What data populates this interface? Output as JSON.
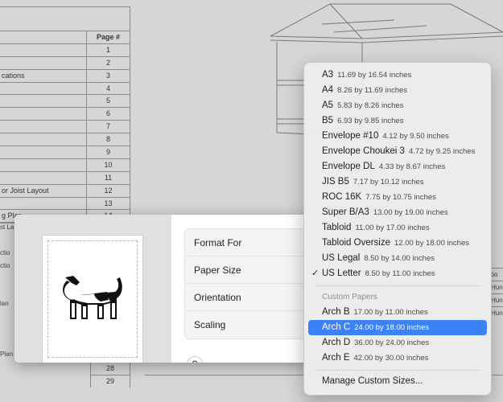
{
  "background_document": {
    "toc_header": "Page #",
    "toc_rows": [
      {
        "text": "",
        "page": "1"
      },
      {
        "text": "",
        "page": "2"
      },
      {
        "text": "cations",
        "page": "3"
      },
      {
        "text": "",
        "page": "4"
      },
      {
        "text": "",
        "page": "5"
      },
      {
        "text": "",
        "page": "6"
      },
      {
        "text": "",
        "page": "7"
      },
      {
        "text": "",
        "page": "8"
      },
      {
        "text": "",
        "page": "9"
      },
      {
        "text": "",
        "page": "10"
      },
      {
        "text": "",
        "page": "11"
      },
      {
        "text": "or Joist Layout",
        "page": "12"
      },
      {
        "text": "",
        "page": "13"
      },
      {
        "text": "g Plan",
        "page": "14"
      }
    ],
    "left_fragments": [
      "st La",
      "ctio",
      "ctio",
      "lan",
      "Plan"
    ],
    "bottom_pages": [
      "28",
      "29"
    ],
    "right_fragments": [
      "tio",
      "Hun",
      "Hun",
      "Hun"
    ]
  },
  "print_sheet": {
    "settings": {
      "format_for": "Format For",
      "paper_size": "Paper Size",
      "orientation": "Orientation",
      "scaling": "Scaling"
    },
    "help_label": "?"
  },
  "paper_menu": {
    "standard_items": [
      {
        "name": "A3",
        "dims": "11.69 by 16.54 inches"
      },
      {
        "name": "A4",
        "dims": "8.26 by 11.69 inches"
      },
      {
        "name": "A5",
        "dims": "5.83 by 8.26 inches"
      },
      {
        "name": "B5",
        "dims": "6.93 by 9.85 inches"
      },
      {
        "name": "Envelope #10",
        "dims": "4.12 by 9.50 inches"
      },
      {
        "name": "Envelope Choukei 3",
        "dims": "4.72 by 9.25 inches"
      },
      {
        "name": "Envelope DL",
        "dims": "4.33 by 8.67 inches"
      },
      {
        "name": "JIS B5",
        "dims": "7.17 by 10.12 inches"
      },
      {
        "name": "ROC 16K",
        "dims": "7.75 by 10.75 inches"
      },
      {
        "name": "Super B/A3",
        "dims": "13.00 by 19.00 inches"
      },
      {
        "name": "Tabloid",
        "dims": "11.00 by 17.00 inches"
      },
      {
        "name": "Tabloid Oversize",
        "dims": "12.00 by 18.00 inches"
      },
      {
        "name": "US Legal",
        "dims": "8.50 by 14.00 inches"
      },
      {
        "name": "US Letter",
        "dims": "8.50 by 11.00 inches",
        "checked": true
      }
    ],
    "custom_header": "Custom Papers",
    "custom_items": [
      {
        "name": "Arch B",
        "dims": "17.00 by 11.00 inches"
      },
      {
        "name": "Arch C",
        "dims": "24.00 by 18.00 inches",
        "highlighted": true
      },
      {
        "name": "Arch D",
        "dims": "36.00 by 24.00 inches"
      },
      {
        "name": "Arch E",
        "dims": "42.00 by 30.00 inches"
      }
    ],
    "manage_label": "Manage Custom Sizes...",
    "checkmark": "✓",
    "highlight_color": "#3b82f6"
  }
}
